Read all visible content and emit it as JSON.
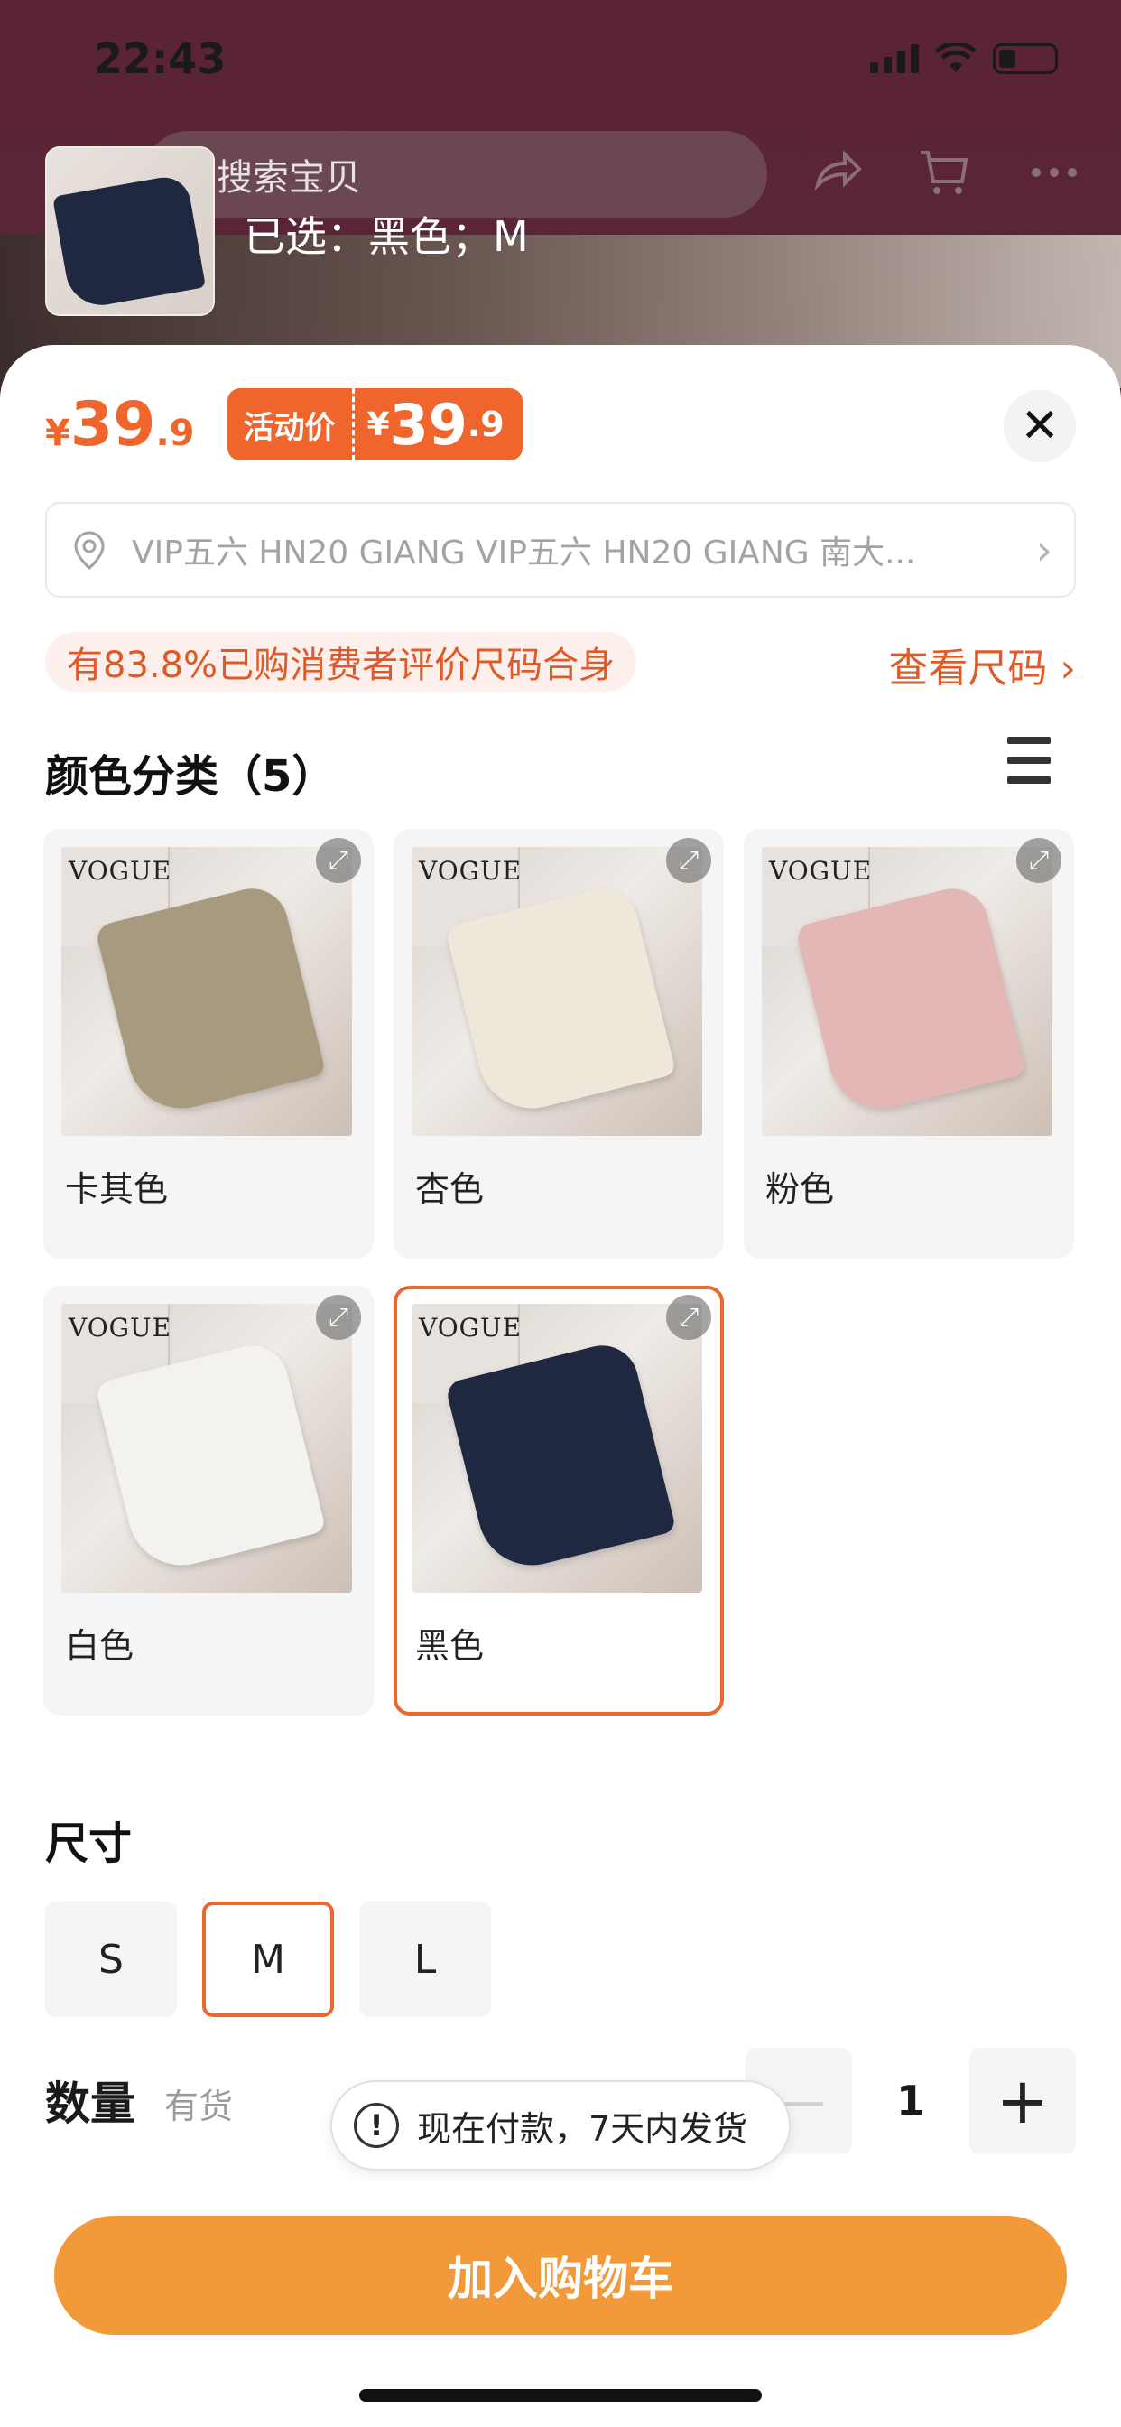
{
  "status_bar": {
    "time": "22:43"
  },
  "header": {
    "search_placeholder": "搜索宝贝",
    "icons": [
      "share-icon",
      "cart-icon",
      "more-icon"
    ],
    "selected_text": "已选：黑色；M"
  },
  "price": {
    "currency": "¥",
    "integer": "39",
    "decimal": ".9",
    "promo_label": "活动价",
    "promo_currency": "¥",
    "promo_integer": "39",
    "promo_decimal": ".9",
    "color": "#f0652b"
  },
  "address": {
    "text": "VIP五六 HN20 GIANG VIP五六 HN20 GIANG 南大..."
  },
  "fit": {
    "badge": "有83.8%已购消费者评价尺码合身",
    "link": "查看尺码 ›"
  },
  "color_section": {
    "title": "颜色分类（5）",
    "options": [
      {
        "label": "卡其色",
        "swatch": "#a79a7f",
        "selected": false
      },
      {
        "label": "杏色",
        "swatch": "#efe7da",
        "selected": false
      },
      {
        "label": "粉色",
        "swatch": "#e2b7b6",
        "selected": false
      },
      {
        "label": "白色",
        "swatch": "#f4f2ef",
        "selected": false
      },
      {
        "label": "黑色",
        "swatch": "#1f2840",
        "selected": true
      }
    ]
  },
  "size_section": {
    "title": "尺寸",
    "options": [
      {
        "label": "S",
        "selected": false
      },
      {
        "label": "M",
        "selected": true
      },
      {
        "label": "L",
        "selected": false
      }
    ]
  },
  "quantity": {
    "label": "数量",
    "stock": "有货",
    "value": "1",
    "minus": "—",
    "plus": "+"
  },
  "toast": {
    "icon": "!",
    "text": "现在付款，7天内发货"
  },
  "cta": {
    "label": "加入购物车",
    "color": "#f2993a"
  },
  "close_icon": "✕",
  "accent_color": "#e9682f"
}
